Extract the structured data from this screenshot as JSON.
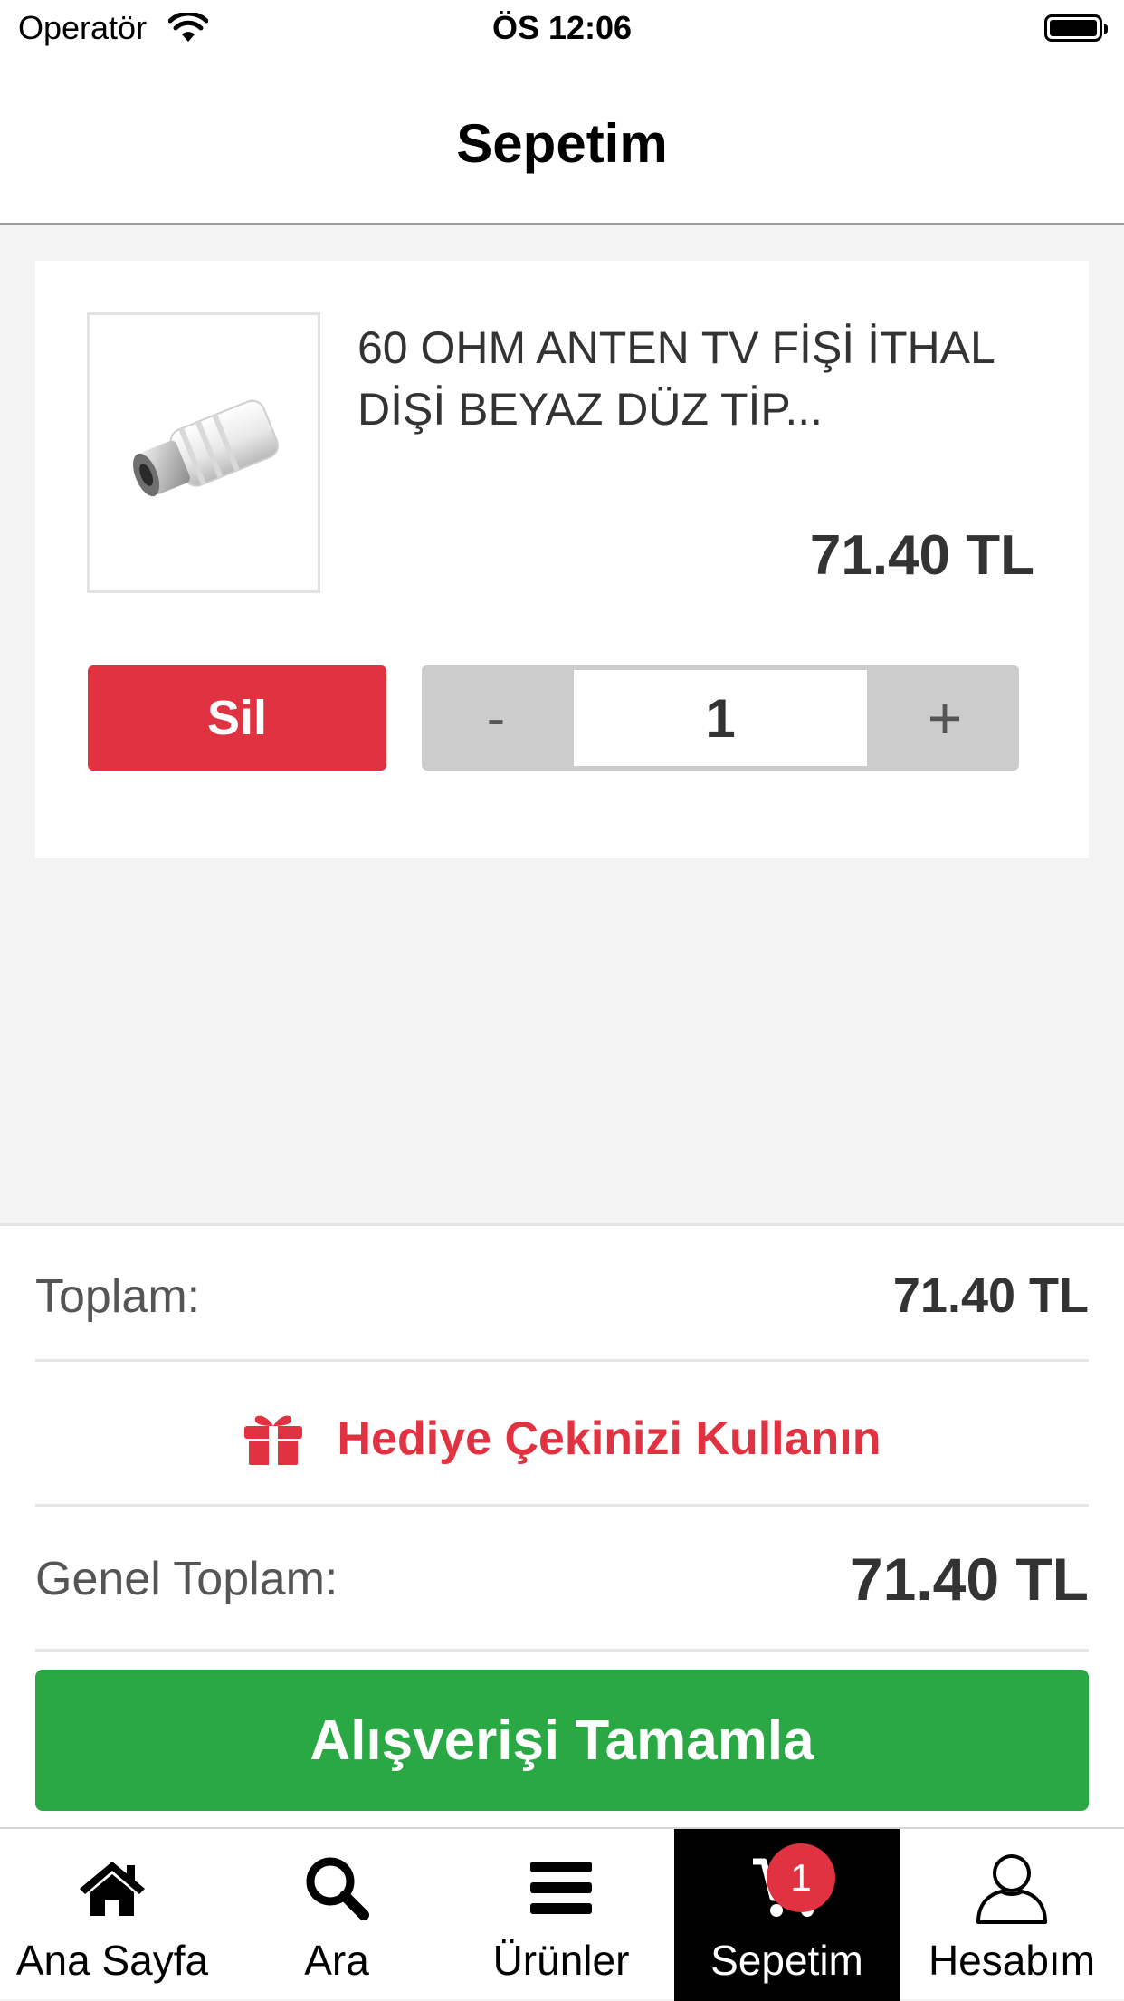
{
  "status_bar": {
    "carrier": "Operatör",
    "time": "ÖS 12:06"
  },
  "header": {
    "title": "Sepetim"
  },
  "cart": {
    "items": [
      {
        "name": "60 OHM ANTEN TV FİŞİ İTHAL DİŞİ BEYAZ DÜZ TİP...",
        "price": "71.40 TL",
        "quantity": "1",
        "delete_label": "Sil",
        "minus_label": "-",
        "plus_label": "+"
      }
    ]
  },
  "summary": {
    "subtotal_label": "Toplam:",
    "subtotal_value": "71.40 TL",
    "gift_label": "Hediye Çekinizi Kullanın",
    "total_label": "Genel Toplam:",
    "total_value": "71.40 TL",
    "checkout_label": "Alışverişi Tamamla"
  },
  "tabbar": {
    "items": [
      {
        "label": "Ana Sayfa",
        "icon": "home-icon"
      },
      {
        "label": "Ara",
        "icon": "search-icon"
      },
      {
        "label": "Ürünler",
        "icon": "menu-icon"
      },
      {
        "label": "Sepetim",
        "icon": "cart-icon",
        "active": true
      },
      {
        "label": "Hesabım",
        "icon": "user-icon"
      }
    ],
    "cart_badge": "1"
  },
  "colors": {
    "accent_red": "#e03240",
    "checkout_green": "#29a844",
    "background": "#f3f3f3"
  }
}
